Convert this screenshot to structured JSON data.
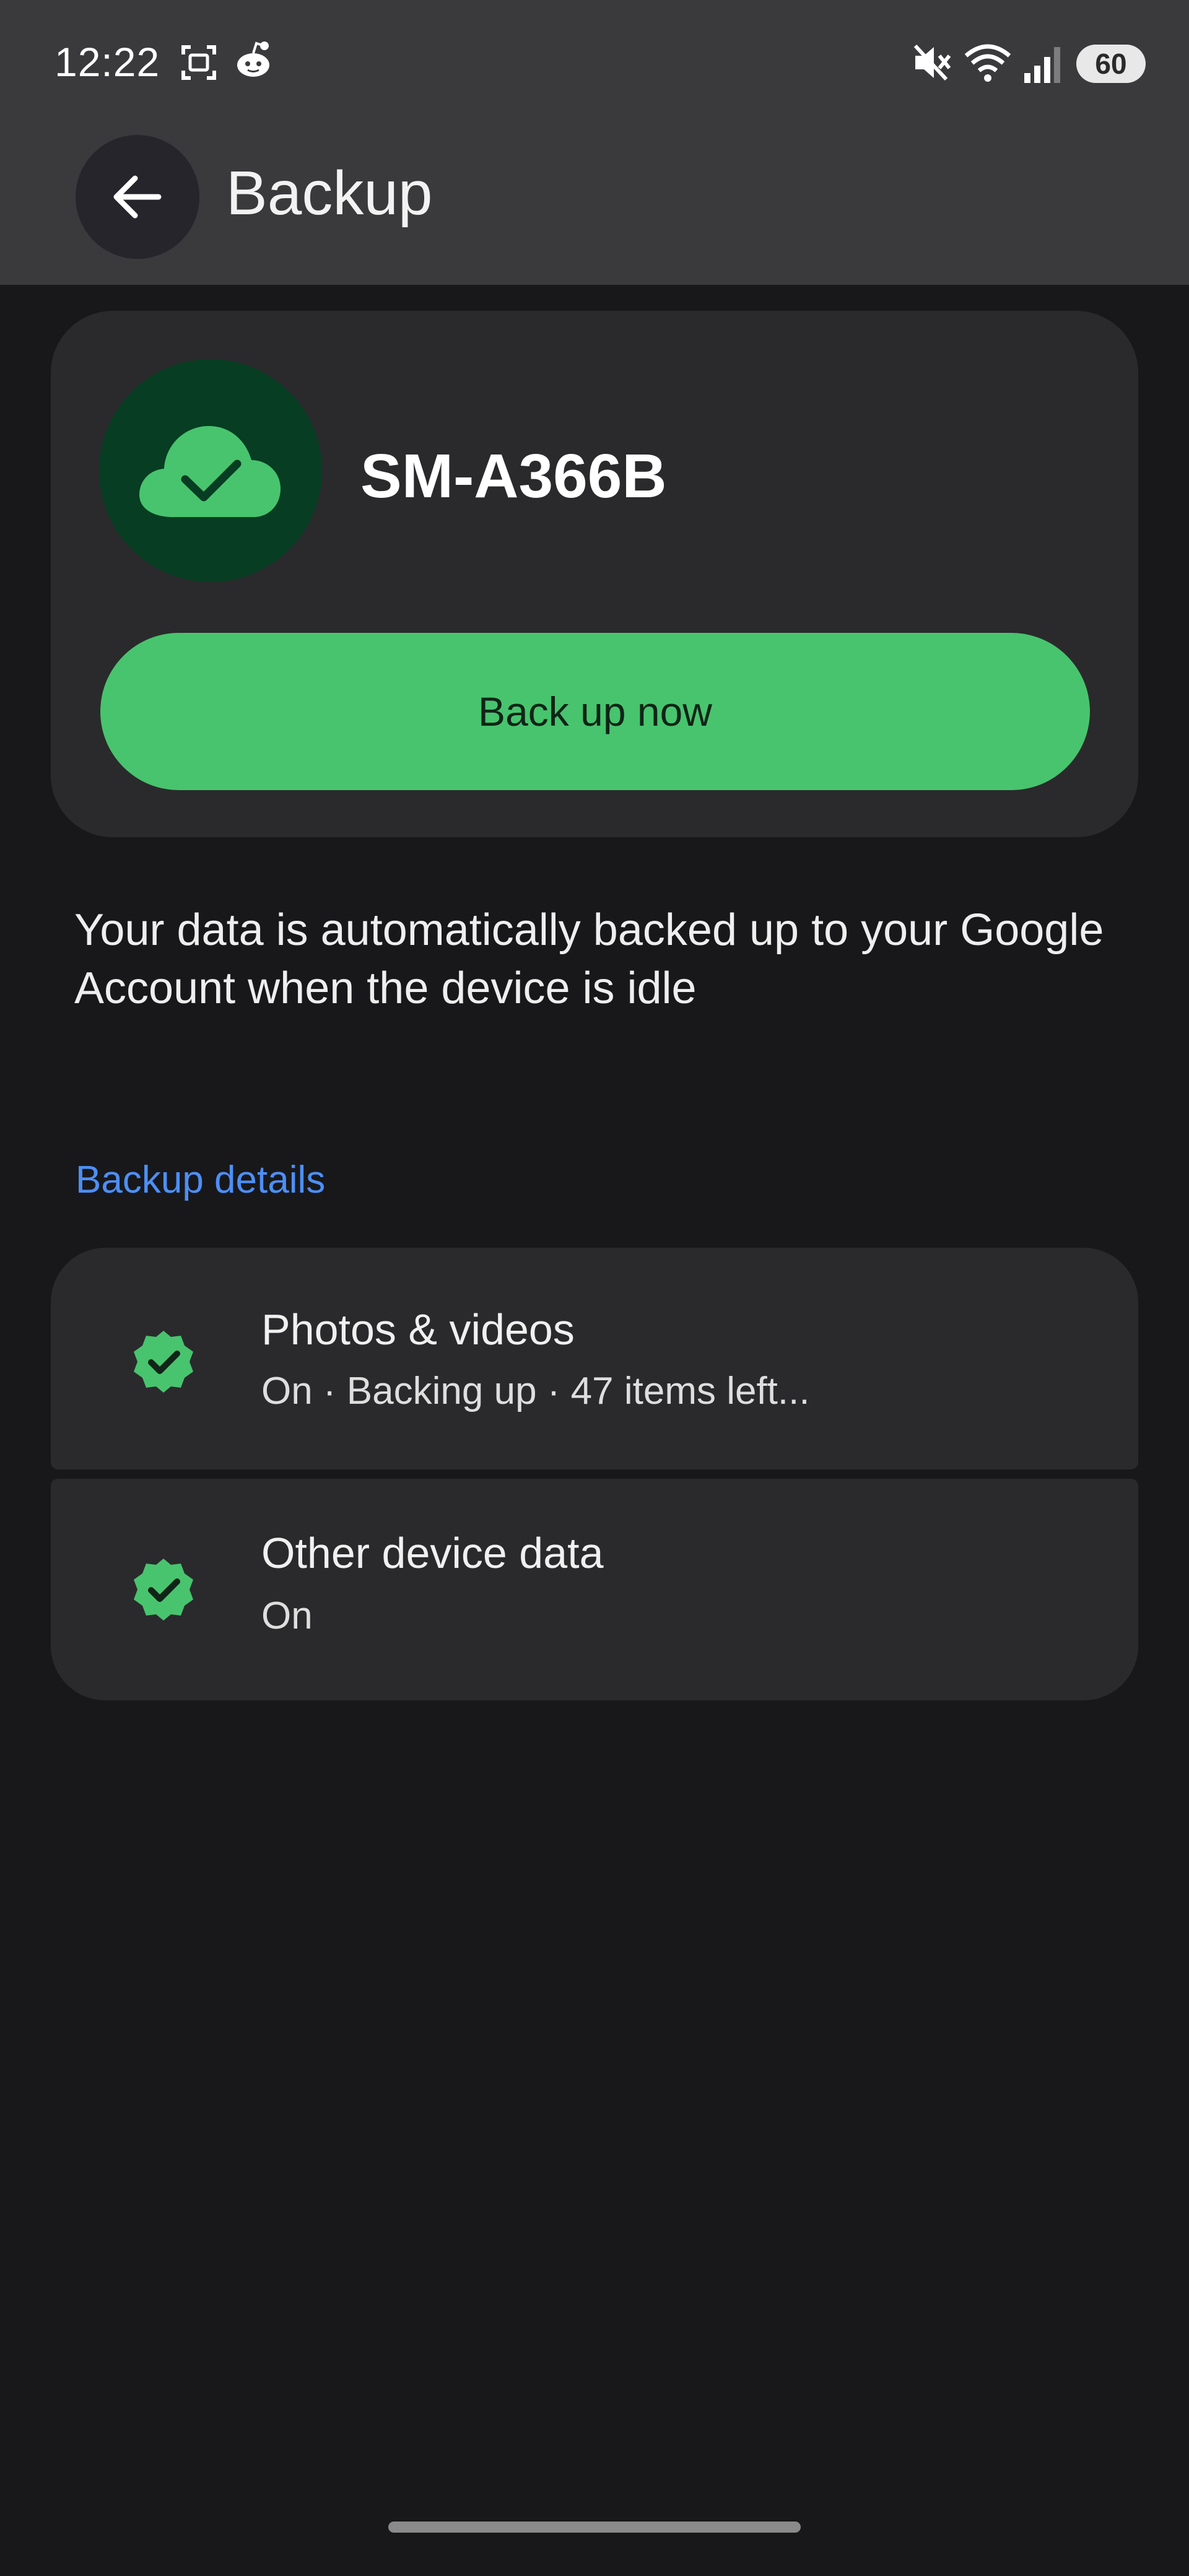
{
  "status_bar": {
    "time": "12:22",
    "battery": "60",
    "icons": [
      "screenshot-icon",
      "reddit-icon",
      "mute-icon",
      "wifi-icon",
      "signal-icon"
    ]
  },
  "header": {
    "title": "Backup",
    "back_icon": "arrow-left-icon"
  },
  "device_card": {
    "device_name": "SM-A366B",
    "icon": "cloud-check-icon",
    "backup_now_label": "Back up now"
  },
  "description": "Your data is automatically backed up to your Google Account when the device is idle",
  "backup_details": {
    "section_title": "Backup details",
    "items": [
      {
        "title": "Photos & videos",
        "subtitle": "On · Backing up · 47 items left...",
        "icon": "check-badge-icon"
      },
      {
        "title": "Other device data",
        "subtitle": "On",
        "icon": "check-badge-icon"
      }
    ]
  },
  "colors": {
    "background": "#18181b",
    "header": "#3a3a3c",
    "card": "#2a2a2c",
    "accent_green": "#48c46e",
    "link_blue": "#4d8ff5",
    "cloud_circle": "#073d22"
  }
}
